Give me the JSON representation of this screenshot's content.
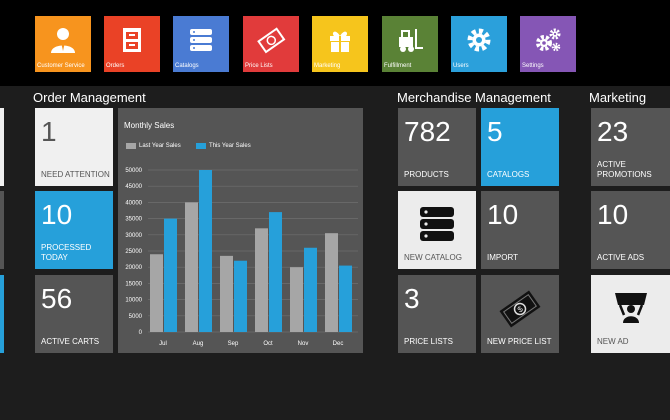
{
  "nav": [
    {
      "label": "Customer Service",
      "color": "#f7941e",
      "icon": "customer-icon"
    },
    {
      "label": "Orders",
      "color": "#ea4226",
      "icon": "cabinet-icon"
    },
    {
      "label": "Catalogs",
      "color": "#4a7bd3",
      "icon": "server-icon"
    },
    {
      "label": "Price Lists",
      "color": "#e13b3b",
      "icon": "price-tag-icon"
    },
    {
      "label": "Marketing",
      "color": "#f6c51c",
      "icon": "gift-icon"
    },
    {
      "label": "Fulfillment",
      "color": "#5a8236",
      "icon": "forklift-icon"
    },
    {
      "label": "Users",
      "color": "#2ba0db",
      "icon": "gear-icon"
    },
    {
      "label": "Settings",
      "color": "#8556b5",
      "icon": "gears-icon"
    }
  ],
  "sections": {
    "order_management": "Order Management",
    "merchandise_management": "Merchandise Management",
    "marketing": "Marketing"
  },
  "orders": {
    "need_attention": {
      "value": "1",
      "label": "NEED ATTENTION"
    },
    "processed_today": {
      "value": "10",
      "label": "PROCESSED TODAY"
    },
    "active_carts": {
      "value": "56",
      "label": "ACTIVE CARTS"
    }
  },
  "merch": {
    "products": {
      "value": "782",
      "label": "PRODUCTS"
    },
    "catalogs": {
      "value": "5",
      "label": "CATALOGS"
    },
    "new_catalog": {
      "label": "NEW CATALOG",
      "icon": "server-icon"
    },
    "import": {
      "value": "10",
      "label": "IMPORT"
    },
    "price_lists": {
      "value": "3",
      "label": "PRICE LISTS"
    },
    "new_price_list": {
      "label": "NEW PRICE LIST",
      "icon": "price-tag-icon"
    }
  },
  "marketing": {
    "active_promotions": {
      "value": "23",
      "label": "ACTIVE PROMOTIONS"
    },
    "active_ads": {
      "value": "10",
      "label": "ACTIVE ADS"
    },
    "new_ad": {
      "label": "NEW AD",
      "icon": "banner-icon"
    }
  },
  "colors": {
    "last_year": "#a6a6a6",
    "this_year": "#26a0da"
  },
  "chart_data": {
    "type": "bar",
    "title": "Monthly Sales",
    "categories": [
      "Jul",
      "Aug",
      "Sep",
      "Oct",
      "Nov",
      "Dec"
    ],
    "series": [
      {
        "name": "Last Year Sales",
        "values": [
          24000,
          40000,
          23500,
          32000,
          20000,
          30500
        ]
      },
      {
        "name": "This Year Sales",
        "values": [
          35000,
          50000,
          22000,
          37000,
          26000,
          20500
        ]
      }
    ],
    "yticks": [
      "0",
      "5000",
      "10000",
      "15000",
      "20000",
      "25000",
      "30000",
      "35000",
      "40000",
      "45000",
      "50000"
    ],
    "ylim": [
      0,
      50000
    ],
    "grid": true,
    "legend": "top-left"
  }
}
